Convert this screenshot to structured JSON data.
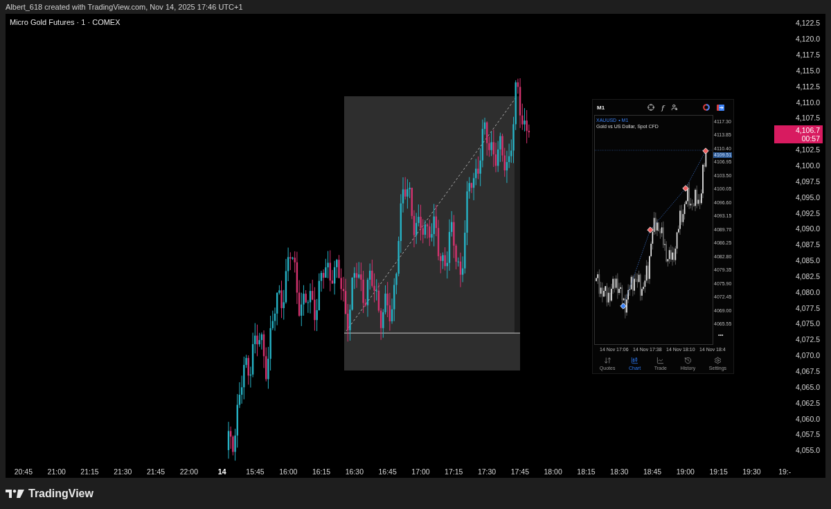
{
  "snapshot_caption": "Albert_618 created with TradingView.com, Nov 14, 2025 17:46 UTC+1",
  "chart": {
    "title": "Micro Gold Futures · 1 · COMEX",
    "price_axis": [
      {
        "kind": "tick",
        "label": "4,122.5"
      },
      {
        "kind": "tick",
        "label": "4,120.0"
      },
      {
        "kind": "tick",
        "label": "4,117.5"
      },
      {
        "kind": "tick",
        "label": "4,115.0"
      },
      {
        "kind": "tick",
        "label": "4,112.5"
      },
      {
        "kind": "tick",
        "label": "4,110.0"
      },
      {
        "kind": "tick",
        "label": "4,107.5"
      },
      {
        "kind": "badge",
        "price": "4,106.7",
        "countdown": "00:57"
      },
      {
        "kind": "tick",
        "label": "4,102.5"
      },
      {
        "kind": "tick",
        "label": "4,100.0"
      },
      {
        "kind": "tick",
        "label": "4,097.5"
      },
      {
        "kind": "tick",
        "label": "4,095.0"
      },
      {
        "kind": "tick",
        "label": "4,092.5"
      },
      {
        "kind": "tick",
        "label": "4,090.0"
      },
      {
        "kind": "tick",
        "label": "4,087.5"
      },
      {
        "kind": "tick",
        "label": "4,085.0"
      },
      {
        "kind": "tick",
        "label": "4,082.5"
      },
      {
        "kind": "tick",
        "label": "4,080.0"
      },
      {
        "kind": "tick",
        "label": "4,077.5"
      },
      {
        "kind": "tick",
        "label": "4,075.0"
      },
      {
        "kind": "tick",
        "label": "4,072.5"
      },
      {
        "kind": "tick",
        "label": "4,070.0"
      },
      {
        "kind": "tick",
        "label": "4,067.5"
      },
      {
        "kind": "tick",
        "label": "4,065.0"
      },
      {
        "kind": "tick",
        "label": "4,062.5"
      },
      {
        "kind": "tick",
        "label": "4,060.0"
      },
      {
        "kind": "tick",
        "label": "4,057.5"
      },
      {
        "kind": "tick",
        "label": "4,055.0"
      }
    ],
    "time_axis": [
      {
        "kind": "time",
        "label": "20:45"
      },
      {
        "kind": "time",
        "label": "21:00"
      },
      {
        "kind": "time",
        "label": "21:15"
      },
      {
        "kind": "time",
        "label": "21:30"
      },
      {
        "kind": "time",
        "label": "21:45"
      },
      {
        "kind": "time",
        "label": "22:00"
      },
      {
        "kind": "day",
        "label": "14"
      },
      {
        "kind": "time",
        "label": "15:45"
      },
      {
        "kind": "time",
        "label": "16:00"
      },
      {
        "kind": "time",
        "label": "16:15"
      },
      {
        "kind": "time",
        "label": "16:30"
      },
      {
        "kind": "time",
        "label": "16:45"
      },
      {
        "kind": "time",
        "label": "17:00"
      },
      {
        "kind": "time",
        "label": "17:15"
      },
      {
        "kind": "time",
        "label": "17:30"
      },
      {
        "kind": "time",
        "label": "17:45"
      },
      {
        "kind": "time",
        "label": "18:00"
      },
      {
        "kind": "time",
        "label": "18:15"
      },
      {
        "kind": "time",
        "label": "18:30"
      },
      {
        "kind": "time",
        "label": "18:45"
      },
      {
        "kind": "time",
        "label": "19:00"
      },
      {
        "kind": "time",
        "label": "19:15"
      },
      {
        "kind": "time",
        "label": "19:30"
      },
      {
        "kind": "time",
        "label": "19:-"
      }
    ]
  },
  "inset_app": {
    "timeframe": "M1",
    "function_symbol": "f",
    "symbol": "XAUUSD",
    "symbol_timeframe": "• M1",
    "description": "Gold vs US Dollar, Spot CFD",
    "price_axis": [
      "4117.30",
      "4113.85",
      "4110.40",
      "4106.95",
      "4103.50",
      "4100.05",
      "4096.60",
      "4093.15",
      "4089.70",
      "4086.25",
      "4082.80",
      "4079.35",
      "4075.90",
      "4072.45",
      "4069.00",
      "4065.55"
    ],
    "current_price": "4109.51",
    "more": "•••",
    "time_axis": [
      "14 Nov 17:06",
      "14 Nov 17:38",
      "14 Nov 18:10",
      "14 Nov 18:4"
    ],
    "tabs": [
      {
        "label": "Quotes",
        "kind": "quotes",
        "selected": false
      },
      {
        "label": "Chart",
        "kind": "chart",
        "selected": true
      },
      {
        "label": "Trade",
        "kind": "trade",
        "selected": false
      },
      {
        "label": "History",
        "kind": "history",
        "selected": false
      },
      {
        "label": "Settings",
        "kind": "settings",
        "selected": false
      }
    ]
  },
  "brand": "TradingView"
}
